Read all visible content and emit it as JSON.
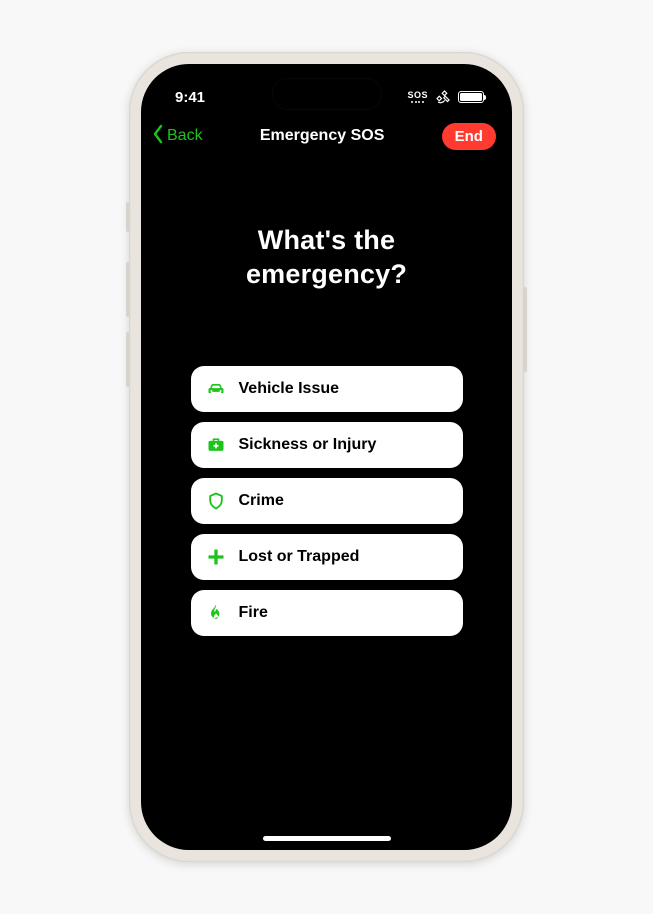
{
  "status": {
    "time": "9:41",
    "sos_label": "SOS"
  },
  "nav": {
    "back_label": "Back",
    "title": "Emergency SOS",
    "end_label": "End"
  },
  "heading": "What's the emergency?",
  "options": [
    {
      "icon": "car",
      "label": "Vehicle Issue"
    },
    {
      "icon": "medkit",
      "label": "Sickness or Injury"
    },
    {
      "icon": "shield",
      "label": "Crime"
    },
    {
      "icon": "plus",
      "label": "Lost or Trapped"
    },
    {
      "icon": "flame",
      "label": "Fire"
    }
  ]
}
